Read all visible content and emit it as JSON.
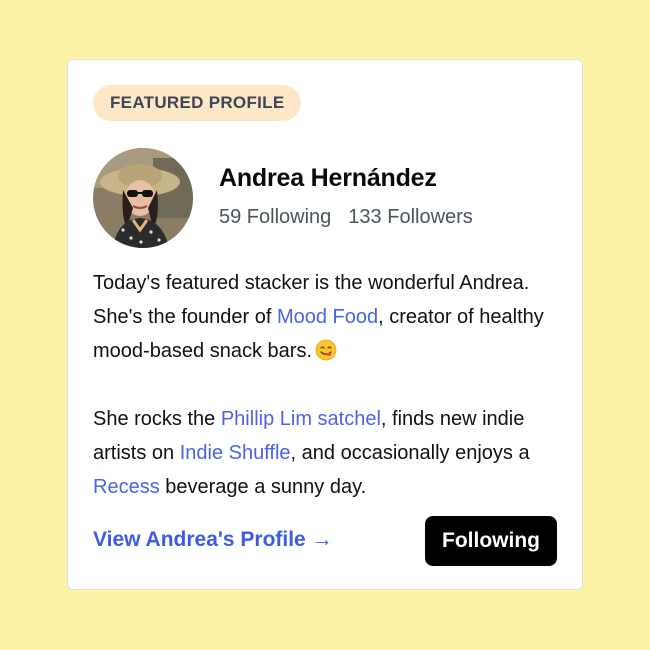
{
  "card": {
    "badge": "FEATURED PROFILE",
    "name": "Andrea Hernández",
    "following": "59 Following",
    "followers": "133 Followers",
    "bio": {
      "p1_text_1": "Today's featured stacker is the wonderful Andrea. She's the founder of ",
      "p1_link_1": "Mood Food",
      "p1_text_2": ", creator of healthy mood-based snack bars.",
      "p2_text_1": "She rocks the ",
      "p2_link_1": "Phillip Lim satchel",
      "p2_text_2": ", finds new indie artists on ",
      "p2_link_2": "Indie Shuffle",
      "p2_text_3": ", and occasionally enjoys a ",
      "p2_link_3": "Recess",
      "p2_text_4": " beverage a sunny day."
    },
    "profile_link": "View Andrea's Profile →",
    "follow_button": "Following"
  },
  "icons": {
    "emoji": "yum-face-icon"
  },
  "colors": {
    "background": "#fcf2a6",
    "badge_bg": "#fde7c7",
    "link": "#4a63e8",
    "button_bg": "#000000"
  }
}
